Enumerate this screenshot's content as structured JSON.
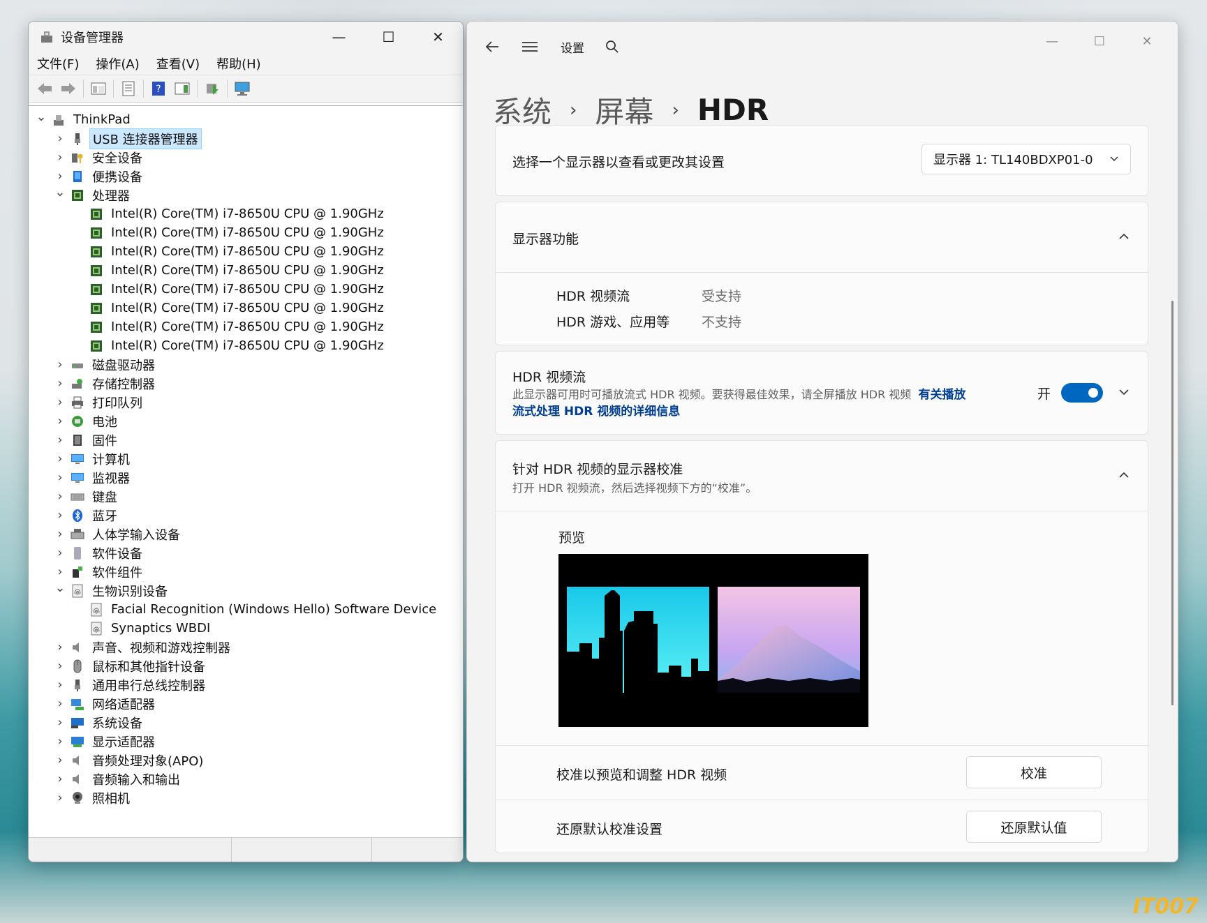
{
  "device_manager": {
    "title": "设备管理器",
    "window_buttons": {
      "minimize": "—",
      "maximize": "☐",
      "close": "✕"
    },
    "menu": [
      "文件(F)",
      "操作(A)",
      "查看(V)",
      "帮助(H)"
    ],
    "tree": [
      {
        "level": 0,
        "expander": "open",
        "label": "ThinkPad",
        "icon": "computer-icon"
      },
      {
        "level": 1,
        "expander": "closed",
        "label": "USB 连接器管理器",
        "icon": "usb-icon",
        "selected": true
      },
      {
        "level": 1,
        "expander": "closed",
        "label": "安全设备",
        "icon": "key-icon"
      },
      {
        "level": 1,
        "expander": "closed",
        "label": "便携设备",
        "icon": "portable-device-icon"
      },
      {
        "level": 1,
        "expander": "open",
        "label": "处理器",
        "icon": "processor-icon"
      },
      {
        "level": 2,
        "expander": "none",
        "label": "Intel(R) Core(TM) i7-8650U CPU @ 1.90GHz",
        "icon": "processor-icon"
      },
      {
        "level": 2,
        "expander": "none",
        "label": "Intel(R) Core(TM) i7-8650U CPU @ 1.90GHz",
        "icon": "processor-icon"
      },
      {
        "level": 2,
        "expander": "none",
        "label": "Intel(R) Core(TM) i7-8650U CPU @ 1.90GHz",
        "icon": "processor-icon"
      },
      {
        "level": 2,
        "expander": "none",
        "label": "Intel(R) Core(TM) i7-8650U CPU @ 1.90GHz",
        "icon": "processor-icon"
      },
      {
        "level": 2,
        "expander": "none",
        "label": "Intel(R) Core(TM) i7-8650U CPU @ 1.90GHz",
        "icon": "processor-icon"
      },
      {
        "level": 2,
        "expander": "none",
        "label": "Intel(R) Core(TM) i7-8650U CPU @ 1.90GHz",
        "icon": "processor-icon"
      },
      {
        "level": 2,
        "expander": "none",
        "label": "Intel(R) Core(TM) i7-8650U CPU @ 1.90GHz",
        "icon": "processor-icon"
      },
      {
        "level": 2,
        "expander": "none",
        "label": "Intel(R) Core(TM) i7-8650U CPU @ 1.90GHz",
        "icon": "processor-icon"
      },
      {
        "level": 1,
        "expander": "closed",
        "label": "磁盘驱动器",
        "icon": "disk-drive-icon"
      },
      {
        "level": 1,
        "expander": "closed",
        "label": "存储控制器",
        "icon": "storage-controller-icon"
      },
      {
        "level": 1,
        "expander": "closed",
        "label": "打印队列",
        "icon": "printer-icon"
      },
      {
        "level": 1,
        "expander": "closed",
        "label": "电池",
        "icon": "battery-icon"
      },
      {
        "level": 1,
        "expander": "closed",
        "label": "固件",
        "icon": "firmware-icon"
      },
      {
        "level": 1,
        "expander": "closed",
        "label": "计算机",
        "icon": "monitor-icon"
      },
      {
        "level": 1,
        "expander": "closed",
        "label": "监视器",
        "icon": "monitor-icon"
      },
      {
        "level": 1,
        "expander": "closed",
        "label": "键盘",
        "icon": "keyboard-icon"
      },
      {
        "level": 1,
        "expander": "closed",
        "label": "蓝牙",
        "icon": "bluetooth-icon"
      },
      {
        "level": 1,
        "expander": "closed",
        "label": "人体学输入设备",
        "icon": "hid-icon"
      },
      {
        "level": 1,
        "expander": "closed",
        "label": "软件设备",
        "icon": "software-device-icon"
      },
      {
        "level": 1,
        "expander": "closed",
        "label": "软件组件",
        "icon": "software-component-icon"
      },
      {
        "level": 1,
        "expander": "open",
        "label": "生物识别设备",
        "icon": "fingerprint-icon"
      },
      {
        "level": 2,
        "expander": "none",
        "label": "Facial Recognition (Windows Hello) Software Device",
        "icon": "fingerprint-icon"
      },
      {
        "level": 2,
        "expander": "none",
        "label": "Synaptics WBDI",
        "icon": "fingerprint-icon"
      },
      {
        "level": 1,
        "expander": "closed",
        "label": "声音、视频和游戏控制器",
        "icon": "speaker-icon"
      },
      {
        "level": 1,
        "expander": "closed",
        "label": "鼠标和其他指针设备",
        "icon": "mouse-icon"
      },
      {
        "level": 1,
        "expander": "closed",
        "label": "通用串行总线控制器",
        "icon": "usb-icon"
      },
      {
        "level": 1,
        "expander": "closed",
        "label": "网络适配器",
        "icon": "network-icon"
      },
      {
        "level": 1,
        "expander": "closed",
        "label": "系统设备",
        "icon": "system-device-icon"
      },
      {
        "level": 1,
        "expander": "closed",
        "label": "显示适配器",
        "icon": "display-adapter-icon"
      },
      {
        "level": 1,
        "expander": "closed",
        "label": "音频处理对象(APO)",
        "icon": "speaker-icon"
      },
      {
        "level": 1,
        "expander": "closed",
        "label": "音频输入和输出",
        "icon": "speaker-icon"
      },
      {
        "level": 1,
        "expander": "closed",
        "label": "照相机",
        "icon": "camera-icon"
      }
    ]
  },
  "settings": {
    "app_title": "设置",
    "window_buttons": {
      "minimize": "—",
      "maximize": "☐",
      "close": "✕"
    },
    "breadcrumb": {
      "first": "系统",
      "second": "屏幕",
      "current": "HDR",
      "separator": "›"
    },
    "select_display": {
      "label": "选择一个显示器以查看或更改其设置",
      "value": "显示器 1: TL140BDXP01-0"
    },
    "capabilities": {
      "title": "显示器功能",
      "rows": [
        {
          "name": "HDR 视频流",
          "value": "受支持"
        },
        {
          "name": "HDR 游戏、应用等",
          "value": "不支持"
        }
      ]
    },
    "hdr_stream": {
      "title": "HDR 视频流",
      "description": "此显示器可用时可播放流式 HDR 视频。要获得最佳效果，请全屏播放 HDR 视频",
      "link_line1": "有关播放",
      "link_line2": "流式处理 HDR 视频的详细信息",
      "toggle_label": "开",
      "toggle_on": true
    },
    "calibration": {
      "title": "针对 HDR 视频的显示器校准",
      "description": "打开 HDR 视频流，然后选择视频下方的“校准”。",
      "preview_label": "预览",
      "calibrate_row": "校准以预览和调整 HDR 视频",
      "calibrate_button": "校准",
      "reset_row": "还原默认校准设置",
      "reset_button": "还原默认值"
    }
  },
  "watermark": "IT007",
  "colors": {
    "accent": "#0067c0",
    "link": "#003e92"
  }
}
